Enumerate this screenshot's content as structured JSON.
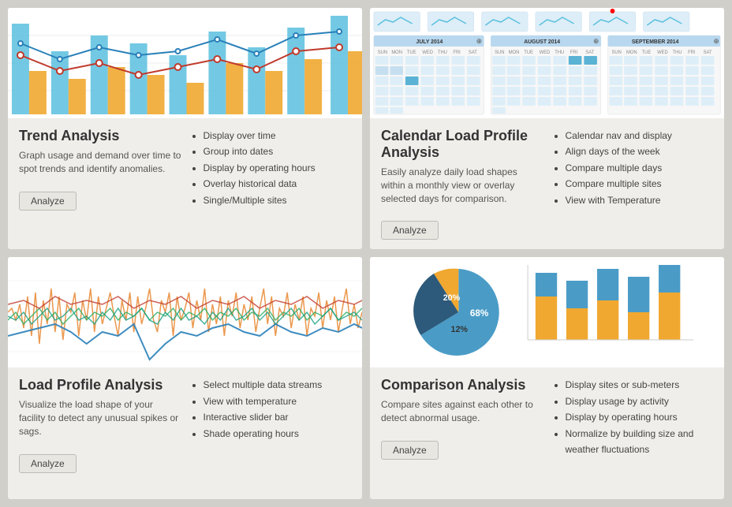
{
  "cards": [
    {
      "id": "trend",
      "title": "Trend Analysis",
      "description": "Graph usage and demand over time to spot trends and identify anomalies.",
      "features": [
        "Display over time",
        "Group into dates",
        "Display by operating hours",
        "Overlay historical data",
        "Single/Multiple sites"
      ],
      "button": "Analyze"
    },
    {
      "id": "calendar",
      "title": "Calendar Load Profile Analysis",
      "description": "Easily analyze daily load shapes within a monthly view or overlay selected days for comparison.",
      "features": [
        "Calendar nav and display",
        "Align days of the week",
        "Compare multiple days",
        "Compare multiple sites",
        "View with Temperature"
      ],
      "button": "Analyze"
    },
    {
      "id": "load",
      "title": "Load Profile Analysis",
      "description": "Visualize the load shape of your facility to detect any unusual spikes or sags.",
      "features": [
        "Select multiple data streams",
        "View with temperature",
        "Interactive slider bar",
        "Shade operating hours"
      ],
      "button": "Analyze"
    },
    {
      "id": "comparison",
      "title": "Comparison Analysis",
      "description": "Compare sites against each other to detect abnormal usage.",
      "features": [
        "Display sites or sub-meters",
        "Display usage by activity",
        "Display by operating hours",
        "Normalize by building size and weather fluctuations"
      ],
      "button": "Analyze"
    }
  ],
  "calendar": {
    "months": [
      "JULY 2014",
      "AUGUST 2014",
      "SEPTEMBER 2014"
    ],
    "days": [
      "SUN",
      "MON",
      "TUE",
      "WED",
      "THU",
      "FRI",
      "SAT"
    ]
  },
  "pie": {
    "segments": [
      {
        "label": "68%",
        "color": "#4a9cc7",
        "value": 68
      },
      {
        "label": "20%",
        "color": "#2d5a7a",
        "value": 20
      },
      {
        "label": "12%",
        "color": "#f0a830",
        "value": 12
      }
    ]
  }
}
